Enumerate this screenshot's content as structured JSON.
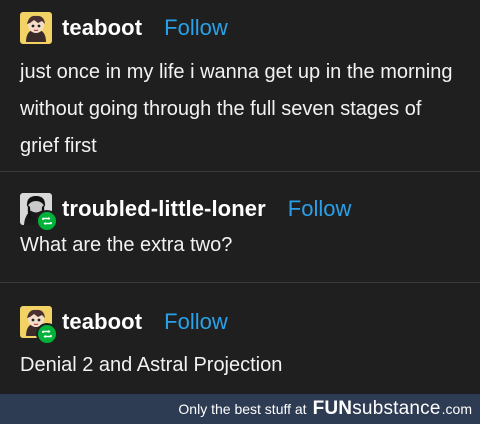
{
  "posts": [
    {
      "username": "teaboot",
      "follow_label": "Follow",
      "text": "just once in my life i wanna get up in the morning without going through the full seven stages of grief first",
      "reblog": false
    },
    {
      "username": "troubled-little-loner",
      "follow_label": "Follow",
      "text": "What are the extra two?",
      "reblog": true
    },
    {
      "username": "teaboot",
      "follow_label": "Follow",
      "text": "Denial 2 and Astral Projection",
      "reblog": true
    }
  ],
  "watermark": {
    "tagline": "Only the best stuff at",
    "brand_fun": "FUN",
    "brand_sub": "substance",
    "tld": ".com"
  },
  "colors": {
    "background": "#1f1f1f",
    "follow": "#29a1e8",
    "reblog_badge": "#00b13a",
    "footer": "#2d3b53"
  },
  "icons": {
    "reblog": "reblog-icon",
    "avatar_teaboot": "avatar",
    "avatar_loner": "avatar"
  }
}
